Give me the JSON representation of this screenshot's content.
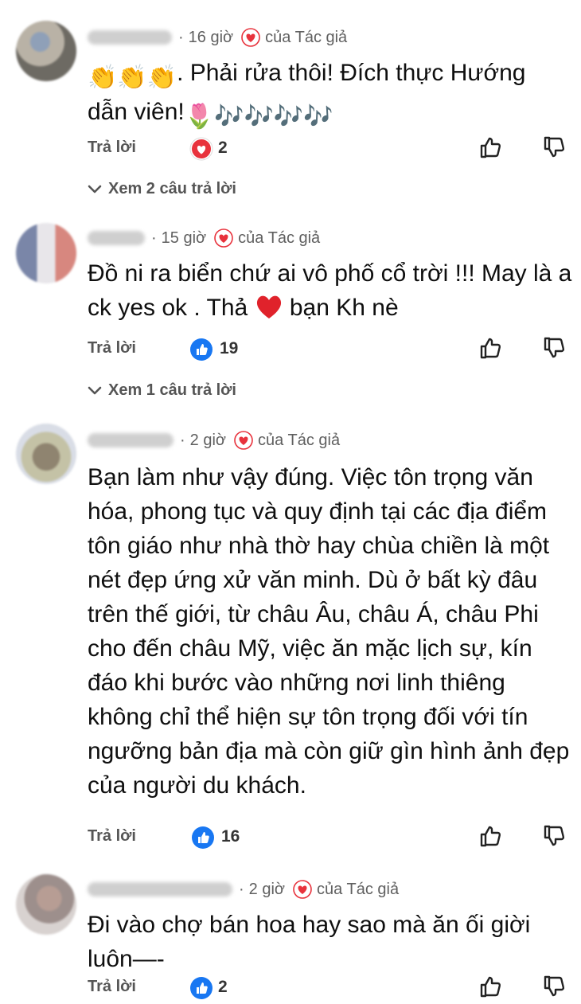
{
  "comments": [
    {
      "time": "16 giờ",
      "author_badge": "của Tác giả",
      "text_parts": [
        "👏👏👏",
        ". Phải rửa thôi! Đích thực Hướng",
        "dẫn viên!",
        "🌷",
        "🎶🎶🎶🎶"
      ],
      "reply_label": "Trả lời",
      "reaction_type": "heart",
      "reaction_count": "2",
      "view_replies": "Xem 2 câu trả lời"
    },
    {
      "time": "15 giờ",
      "author_badge": "của Tác giả",
      "text_line1": "Đồ ni ra biển chứ ai vô phố cổ trời !!! May là a",
      "text_line2_a": "ck yes ok . Thả ",
      "text_line2_b": " bạn Kh nè",
      "reply_label": "Trả lời",
      "reaction_type": "like",
      "reaction_count": "19",
      "view_replies": "Xem 1 câu trả lời"
    },
    {
      "time": "2 giờ",
      "author_badge": "của Tác giả",
      "lines": [
        "Bạn làm như vậy đúng. Việc tôn trọng văn",
        "hóa, phong tục và quy định tại các địa điểm",
        "tôn giáo như nhà thờ hay chùa chiền là một",
        "nét đẹp ứng xử văn minh. Dù ở bất kỳ đâu",
        "trên thế giới, từ châu Âu, châu Á, châu Phi",
        "cho đến châu Mỹ, việc ăn mặc lịch sự, kín",
        "đáo khi bước vào những nơi linh thiêng",
        "không chỉ thể hiện sự tôn trọng đối với tín",
        "ngưỡng bản địa mà còn giữ gìn hình ảnh đẹp",
        "của người du khách."
      ],
      "reply_label": "Trả lời",
      "reaction_type": "like",
      "reaction_count": "16"
    },
    {
      "time": "2 giờ",
      "author_badge": "của Tác giả",
      "lines": [
        "Đi vào chợ bán hoa hay sao mà ăn ối giời",
        "luôn—-"
      ],
      "reply_label": "Trả lời",
      "reaction_type": "like",
      "reaction_count": "2"
    }
  ],
  "colors": {
    "heart": "#e8323c",
    "like_blue": "#1877f2",
    "meta_gray": "#606060"
  },
  "icons": [
    "heart-badge-icon",
    "like-reaction-icon",
    "heart-reaction-icon",
    "thumbs-up-icon",
    "thumbs-down-icon",
    "chevron-down-icon"
  ]
}
